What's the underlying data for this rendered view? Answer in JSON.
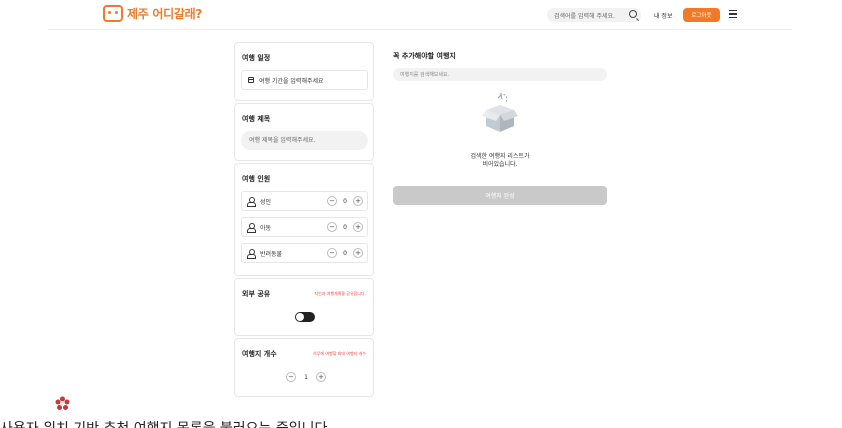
{
  "header": {
    "logo_text": "제주 어디갈래?",
    "search_placeholder": "검색어를 입력해 주세요.",
    "my_info": "내 정보",
    "logout": "로그아웃"
  },
  "schedule": {
    "title": "여행 일정",
    "date_prompt": "여행 기간을 입력해주세요"
  },
  "trip_title": {
    "title": "여행 제목",
    "placeholder": "여행 제목을 입력해주세요."
  },
  "people": {
    "title": "여행 인원",
    "rows": [
      {
        "label": "성인",
        "value": "0"
      },
      {
        "label": "아동",
        "value": "0"
      },
      {
        "label": "반려동물",
        "value": "0"
      }
    ]
  },
  "share": {
    "title": "외부 공유",
    "note": "지인과 여행계획을 공유합니다.",
    "enabled": false
  },
  "place_count": {
    "title": "여행지 개수",
    "note": "하루에 여행할 최대 여행지 개수",
    "value": "1"
  },
  "must_visit": {
    "title": "꼭 추가해야할 여행지",
    "search_placeholder": "여행지를 검색해보세요.",
    "empty_line1": "검색한 여행지 리스트가",
    "empty_line2": "비어있습니다.",
    "complete_button": "여행지 완성"
  },
  "footer_text": "사용자 위치 기반 추천 여행지 목록을 불러오는 중입니다",
  "colors": {
    "brand": "#f07a28",
    "note_red": "#e44444",
    "disabled_button": "#c9c9c9",
    "toggle": "#222222"
  }
}
